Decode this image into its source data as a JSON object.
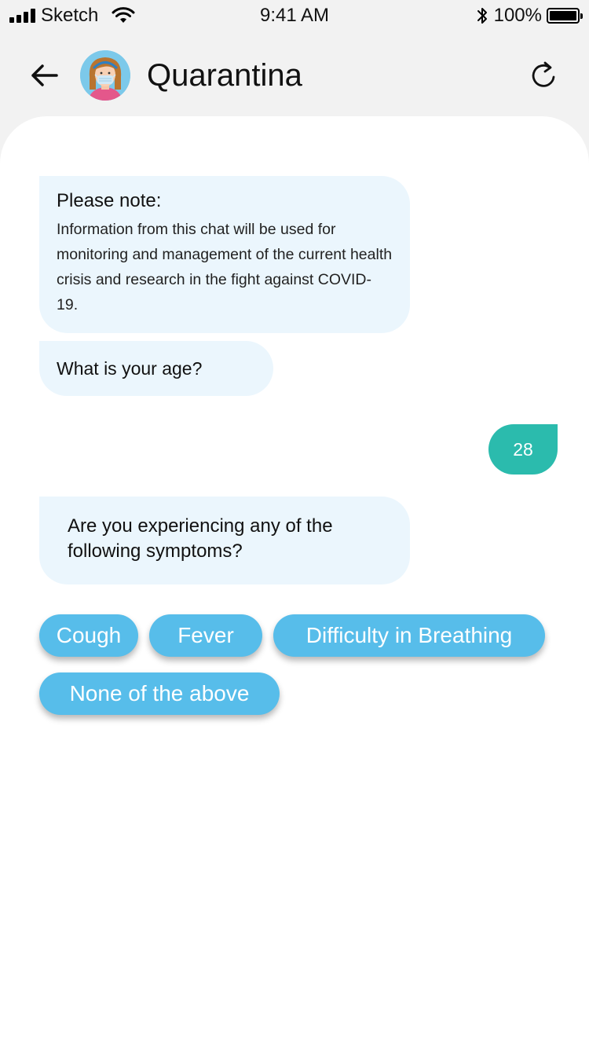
{
  "status_bar": {
    "carrier": "Sketch",
    "time": "9:41 AM",
    "battery": "100%",
    "icons": [
      "signal-icon",
      "wifi-icon",
      "bluetooth-icon",
      "battery-icon"
    ]
  },
  "header": {
    "title": "Quarantina",
    "back_icon": "arrow-left-icon",
    "refresh_icon": "refresh-icon",
    "avatar": "avatar"
  },
  "chat": {
    "note_title": "Please note:",
    "note_body": "Information from this chat will be used for monitoring and management of the current health crisis and research in the fight against COVID-19.",
    "age_question": "What is your age?",
    "user_answer": "28",
    "symptoms_question": "Are you experiencing any of the following symptoms?"
  },
  "options": {
    "cough": "Cough",
    "fever": "Fever",
    "breathing": "Difficulty in Breathing",
    "none": "None of the above"
  },
  "colors": {
    "bot_bubble": "#ebf6fd",
    "user_bubble": "#2bbbad",
    "option_button": "#57bdea",
    "header_bg": "#f2f2f2"
  }
}
